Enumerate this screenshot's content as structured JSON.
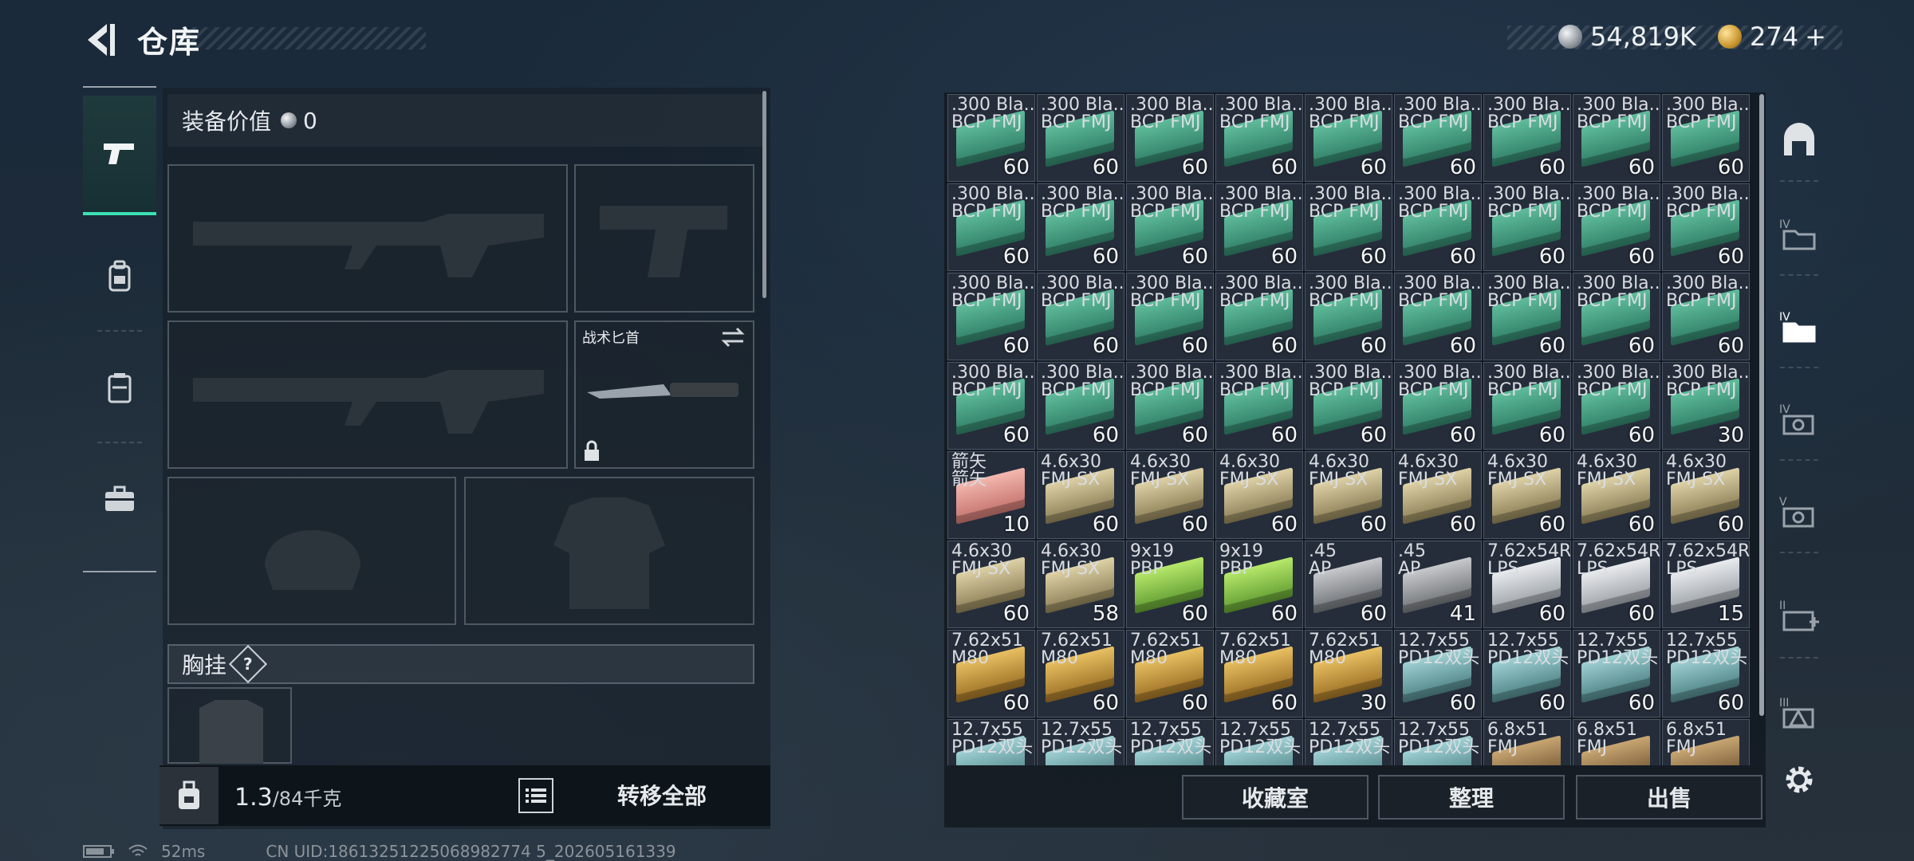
{
  "header": {
    "title": "仓库"
  },
  "currency": {
    "silver": "54,819K",
    "gold": "274",
    "gold_add": "+"
  },
  "equipment": {
    "value_label": "装备价值",
    "value": "0",
    "knife_label": "战术匕首",
    "chest_label": "胸挂",
    "chest_help": "?"
  },
  "bag": {
    "weight_current": "1.3",
    "weight_max": "/84千克",
    "transfer_all": "转移全部"
  },
  "buttons": {
    "collection": "收藏室",
    "sort": "整理",
    "sell": "出售"
  },
  "status": {
    "ping": "52ms",
    "uid": "CN UID:18613251225068982774 5_202605161339"
  },
  "items": [
    {
      "name": ".300 Bla...\nBCP FMJ",
      "count": "60",
      "color": "green"
    },
    {
      "name": ".300 Bla...\nBCP FMJ",
      "count": "60",
      "color": "green"
    },
    {
      "name": ".300 Bla...\nBCP FMJ",
      "count": "60",
      "color": "green"
    },
    {
      "name": ".300 Bla...\nBCP FMJ",
      "count": "60",
      "color": "green"
    },
    {
      "name": ".300 Bla...\nBCP FMJ",
      "count": "60",
      "color": "green"
    },
    {
      "name": ".300 Bla...\nBCP FMJ",
      "count": "60",
      "color": "green"
    },
    {
      "name": ".300 Bla...\nBCP FMJ",
      "count": "60",
      "color": "green"
    },
    {
      "name": ".300 Bla...\nBCP FMJ",
      "count": "60",
      "color": "green"
    },
    {
      "name": ".300 Bla...\nBCP FMJ",
      "count": "60",
      "color": "green"
    },
    {
      "name": ".300 Bla...\nBCP FMJ",
      "count": "60",
      "color": "green"
    },
    {
      "name": ".300 Bla...\nBCP FMJ",
      "count": "60",
      "color": "green"
    },
    {
      "name": ".300 Bla...\nBCP FMJ",
      "count": "60",
      "color": "green"
    },
    {
      "name": ".300 Bla...\nBCP FMJ",
      "count": "60",
      "color": "green"
    },
    {
      "name": ".300 Bla...\nBCP FMJ",
      "count": "60",
      "color": "green"
    },
    {
      "name": ".300 Bla...\nBCP FMJ",
      "count": "60",
      "color": "green"
    },
    {
      "name": ".300 Bla...\nBCP FMJ",
      "count": "60",
      "color": "green"
    },
    {
      "name": ".300 Bla...\nBCP FMJ",
      "count": "60",
      "color": "green"
    },
    {
      "name": ".300 Bla...\nBCP FMJ",
      "count": "60",
      "color": "green"
    },
    {
      "name": ".300 Bla...\nBCP FMJ",
      "count": "60",
      "color": "green"
    },
    {
      "name": ".300 Bla...\nBCP FMJ",
      "count": "60",
      "color": "green"
    },
    {
      "name": ".300 Bla...\nBCP FMJ",
      "count": "60",
      "color": "green"
    },
    {
      "name": ".300 Bla...\nBCP FMJ",
      "count": "60",
      "color": "green"
    },
    {
      "name": ".300 Bla...\nBCP FMJ",
      "count": "60",
      "color": "green"
    },
    {
      "name": ".300 Bla...\nBCP FMJ",
      "count": "60",
      "color": "green"
    },
    {
      "name": ".300 Bla...\nBCP FMJ",
      "count": "60",
      "color": "green"
    },
    {
      "name": ".300 Bla...\nBCP FMJ",
      "count": "60",
      "color": "green"
    },
    {
      "name": ".300 Bla...\nBCP FMJ",
      "count": "60",
      "color": "green"
    },
    {
      "name": ".300 Bla...\nBCP FMJ",
      "count": "60",
      "color": "green"
    },
    {
      "name": ".300 Bla...\nBCP FMJ",
      "count": "60",
      "color": "green"
    },
    {
      "name": ".300 Bla...\nBCP FMJ",
      "count": "60",
      "color": "green"
    },
    {
      "name": ".300 Bla...\nBCP FMJ",
      "count": "60",
      "color": "green"
    },
    {
      "name": ".300 Bla...\nBCP FMJ",
      "count": "60",
      "color": "green"
    },
    {
      "name": ".300 Bla...\nBCP FMJ",
      "count": "60",
      "color": "green"
    },
    {
      "name": ".300 Bla...\nBCP FMJ",
      "count": "60",
      "color": "green"
    },
    {
      "name": ".300 Bla...\nBCP FMJ",
      "count": "60",
      "color": "green"
    },
    {
      "name": ".300 Bla...\nBCP FMJ",
      "count": "30",
      "color": "green"
    },
    {
      "name": "箭矢\n箭矢",
      "count": "10",
      "color": "pink"
    },
    {
      "name": "4.6x30\nFMJ SX",
      "count": "60",
      "color": "tan"
    },
    {
      "name": "4.6x30\nFMJ SX",
      "count": "60",
      "color": "tan"
    },
    {
      "name": "4.6x30\nFMJ SX",
      "count": "60",
      "color": "tan"
    },
    {
      "name": "4.6x30\nFMJ SX",
      "count": "60",
      "color": "tan"
    },
    {
      "name": "4.6x30\nFMJ SX",
      "count": "60",
      "color": "tan"
    },
    {
      "name": "4.6x30\nFMJ SX",
      "count": "60",
      "color": "tan"
    },
    {
      "name": "4.6x30\nFMJ SX",
      "count": "60",
      "color": "tan"
    },
    {
      "name": "4.6x30\nFMJ SX",
      "count": "60",
      "color": "tan"
    },
    {
      "name": "4.6x30\nFMJ SX",
      "count": "60",
      "color": "tan"
    },
    {
      "name": "4.6x30\nFMJ SX",
      "count": "58",
      "color": "tan"
    },
    {
      "name": "9x19\nPBP",
      "count": "60",
      "color": "lime"
    },
    {
      "name": "9x19\nPBP",
      "count": "60",
      "color": "lime"
    },
    {
      "name": ".45\nAP",
      "count": "60",
      "color": "gray"
    },
    {
      "name": ".45\nAP",
      "count": "41",
      "color": "gray"
    },
    {
      "name": "7.62x54R\nLPS",
      "count": "60",
      "color": "white"
    },
    {
      "name": "7.62x54R\nLPS",
      "count": "60",
      "color": "white"
    },
    {
      "name": "7.62x54R\nLPS",
      "count": "15",
      "color": "white"
    },
    {
      "name": "7.62x51\nM80",
      "count": "60",
      "color": "gold"
    },
    {
      "name": "7.62x51\nM80",
      "count": "60",
      "color": "gold"
    },
    {
      "name": "7.62x51\nM80",
      "count": "60",
      "color": "gold"
    },
    {
      "name": "7.62x51\nM80",
      "count": "60",
      "color": "gold"
    },
    {
      "name": "7.62x51\nM80",
      "count": "30",
      "color": "gold"
    },
    {
      "name": "12.7x55\nPD12双头",
      "count": "60",
      "color": "teal"
    },
    {
      "name": "12.7x55\nPD12双头",
      "count": "60",
      "color": "teal"
    },
    {
      "name": "12.7x55\nPD12双头",
      "count": "60",
      "color": "teal"
    },
    {
      "name": "12.7x55\nPD12双头",
      "count": "60",
      "color": "teal"
    },
    {
      "name": "12.7x55\nPD12双头",
      "count": "",
      "color": "teal"
    },
    {
      "name": "12.7x55\nPD12双头",
      "count": "",
      "color": "teal"
    },
    {
      "name": "12.7x55\nPD12双头",
      "count": "",
      "color": "teal"
    },
    {
      "name": "12.7x55\nPD12双头",
      "count": "",
      "color": "teal"
    },
    {
      "name": "12.7x55\nPD12双头",
      "count": "",
      "color": "teal"
    },
    {
      "name": "12.7x55\nPD12双头",
      "count": "",
      "color": "teal"
    },
    {
      "name": "6.8x51\nFMJ",
      "count": "",
      "color": "brown"
    },
    {
      "name": "6.8x51\nFMJ",
      "count": "",
      "color": "brown"
    },
    {
      "name": "6.8x51\nFMJ",
      "count": "",
      "color": "brown"
    }
  ],
  "rail_icons": [
    "armor-rack-icon",
    "folder-iv-icon",
    "folder-iv-active-icon",
    "camera-iv-icon",
    "camera-v-icon",
    "medkit-ii-icon",
    "warning-iii-icon"
  ]
}
